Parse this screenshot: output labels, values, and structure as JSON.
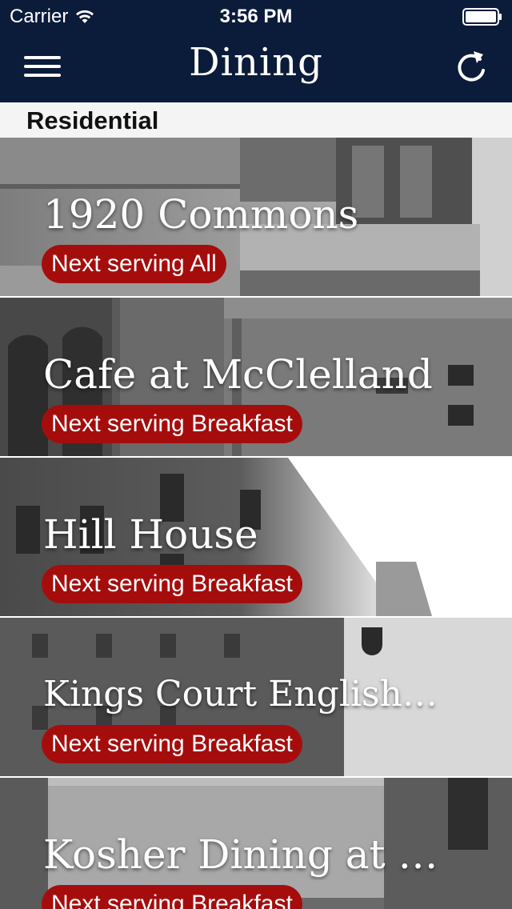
{
  "status_bar": {
    "carrier": "Carrier",
    "time": "3:56 PM"
  },
  "nav": {
    "title": "Dining",
    "menu_icon": "hamburger-menu-icon",
    "refresh_icon": "refresh-icon"
  },
  "section": {
    "title": "Residential"
  },
  "locations": [
    {
      "name": "1920 Commons",
      "next": "Next serving All"
    },
    {
      "name": "Cafe at McClelland",
      "next": "Next serving Breakfast"
    },
    {
      "name": "Hill House",
      "next": "Next serving Breakfast"
    },
    {
      "name": "Kings Court English H…",
      "next": "Next serving Breakfast"
    },
    {
      "name": "Kosher Dining at Falk",
      "next": "Next serving Breakfast"
    }
  ],
  "colors": {
    "nav_background": "#0b1b3a",
    "badge_red": "#a50d0d",
    "section_background": "#f4f4f4"
  }
}
